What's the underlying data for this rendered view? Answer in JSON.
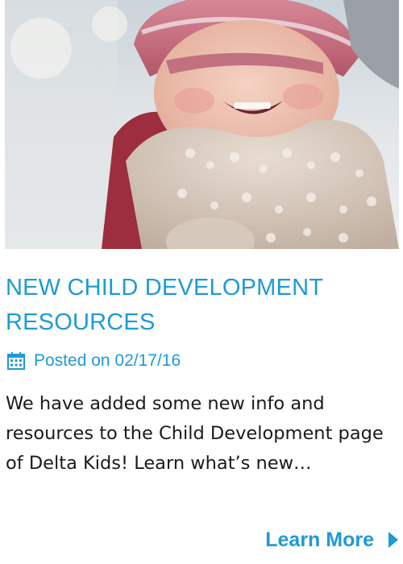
{
  "post": {
    "title": "NEW CHILD DEVELOPMENT RESOURCES",
    "meta_prefix": "Posted on",
    "date": "02/17/16",
    "excerpt": "We have added some new info and resources to the Child Development page of Delta Kids! Learn what’s new…",
    "cta_label": "Learn More"
  },
  "icons": {
    "date": "calendar-icon",
    "cta": "chevron-right-icon"
  },
  "colors": {
    "accent": "#1e9ad6",
    "body_text": "#1a1a1a",
    "background": "#ffffff"
  }
}
